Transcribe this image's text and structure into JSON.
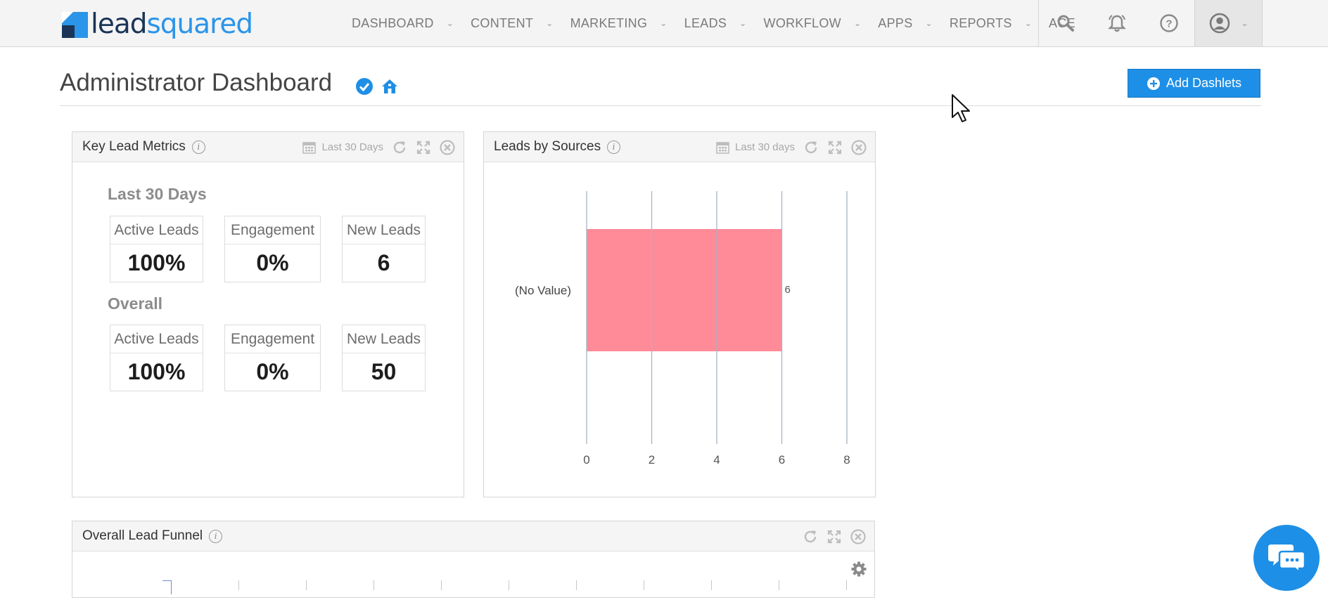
{
  "brand": {
    "lead": "lead",
    "squared": "squared"
  },
  "nav": {
    "items": [
      {
        "label": "DASHBOARD",
        "chevron": true
      },
      {
        "label": "CONTENT",
        "chevron": true
      },
      {
        "label": "MARKETING",
        "chevron": true
      },
      {
        "label": "LEADS",
        "chevron": true
      },
      {
        "label": "WORKFLOW",
        "chevron": true
      },
      {
        "label": "APPS",
        "chevron": true
      },
      {
        "label": "REPORTS",
        "chevron": true
      },
      {
        "label": "ACE",
        "chevron": false
      }
    ],
    "icons": [
      "search-icon",
      "notifications-icon",
      "help-icon",
      "account-icon"
    ]
  },
  "page": {
    "title": "Administrator Dashboard",
    "add_button": "Add Dashlets"
  },
  "key_metrics": {
    "title": "Key Lead Metrics",
    "range": "Last 30 Days",
    "last30": {
      "heading": "Last 30 Days",
      "active_label": "Active Leads",
      "active_value": "100%",
      "engagement_label": "Engagement",
      "engagement_value": "0%",
      "new_label": "New Leads",
      "new_value": "6"
    },
    "overall": {
      "heading": "Overall",
      "active_label": "Active Leads",
      "active_value": "100%",
      "engagement_label": "Engagement",
      "engagement_value": "0%",
      "new_label": "New Leads",
      "new_value": "50"
    }
  },
  "leads_by_sources": {
    "title": "Leads by Sources",
    "range": "Last 30 days"
  },
  "funnel": {
    "title": "Overall Lead Funnel"
  },
  "colors": {
    "accent": "#1e8fe6",
    "bar": "#ff8a98",
    "brand_dark": "#1a3557"
  },
  "chart_data": {
    "type": "bar",
    "orientation": "horizontal",
    "categories": [
      "(No Value)"
    ],
    "values": [
      6
    ],
    "data_labels": [
      "6"
    ],
    "xlim": [
      0,
      8
    ],
    "xticks": [
      "0",
      "2",
      "4",
      "6",
      "8"
    ],
    "grid": true,
    "legend": "none"
  }
}
